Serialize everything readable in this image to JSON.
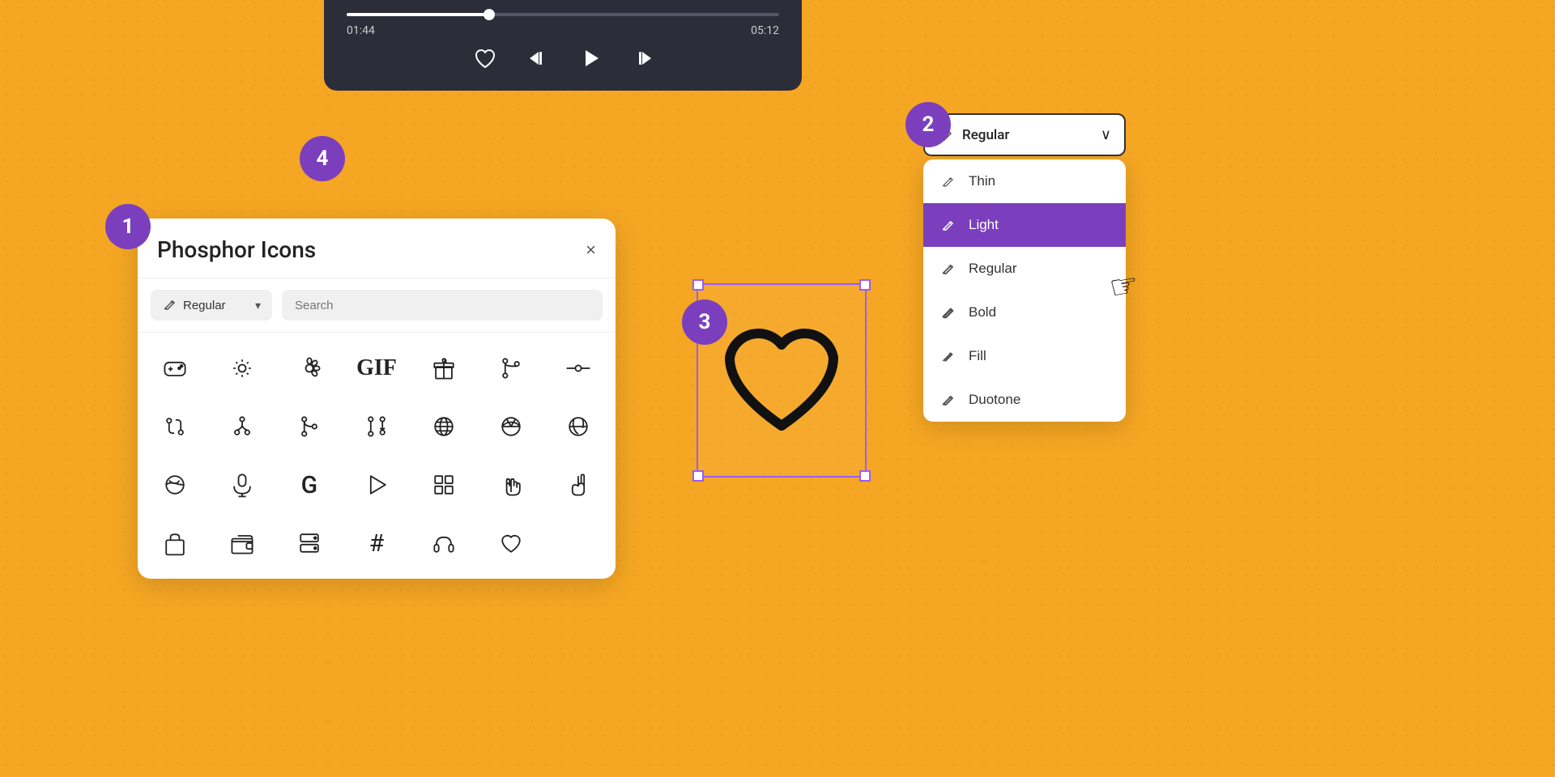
{
  "mediaPlayer": {
    "currentTime": "01:44",
    "totalTime": "05:12",
    "progressPercent": 33
  },
  "badges": {
    "b1": "1",
    "b2": "2",
    "b3": "3",
    "b4": "4"
  },
  "iconsPanel": {
    "title": "Phosphor Icons",
    "closeLabel": "×",
    "styleDropdown": {
      "selected": "Regular",
      "placeholder": "Regular"
    },
    "searchPlaceholder": "Search"
  },
  "stylePanelTrigger": {
    "label": "Regular"
  },
  "styleMenuItems": [
    {
      "id": "thin",
      "label": "Thin",
      "active": false
    },
    {
      "id": "light",
      "label": "Light",
      "active": true
    },
    {
      "id": "regular",
      "label": "Regular",
      "active": false
    },
    {
      "id": "bold",
      "label": "Bold",
      "active": false
    },
    {
      "id": "fill",
      "label": "Fill",
      "active": false
    },
    {
      "id": "duotone",
      "label": "Duotone",
      "active": false
    }
  ],
  "colors": {
    "purple": "#7B3FBE",
    "playerBg": "#2d2d3a",
    "bgOrange": "#F5A623"
  }
}
